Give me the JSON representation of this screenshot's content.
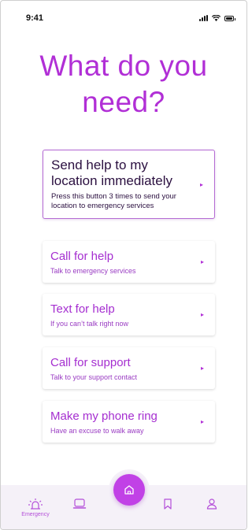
{
  "status_bar": {
    "time": "9:41",
    "signal_icon": "signal-icon",
    "wifi_icon": "wifi-icon",
    "battery_icon": "battery-icon"
  },
  "title": "What do you need?",
  "colors": {
    "accent": "#b12fd6",
    "fab": "#c141e6",
    "nav_bg": "#f5f1f8"
  },
  "actions": [
    {
      "title": "Send help to my location immediately",
      "subtitle": "Press this button 3 times to send your location to emergency services",
      "icon": "chevron-right-icon"
    },
    {
      "title": "Call for help",
      "subtitle": "Talk to emergency services",
      "icon": "chevron-right-icon"
    },
    {
      "title": "Text for help",
      "subtitle": "If you can’t talk right now",
      "icon": "chevron-right-icon"
    },
    {
      "title": "Call for support",
      "subtitle": "Talk to your support contact",
      "icon": "chevron-right-icon"
    },
    {
      "title": "Make my phone ring",
      "subtitle": "Have an excuse to walk away",
      "icon": "chevron-right-icon"
    }
  ],
  "bottom_nav": {
    "items": [
      {
        "label": "Emergency",
        "icon": "siren-icon",
        "active": true
      },
      {
        "label": "",
        "icon": "laptop-icon",
        "active": false
      },
      {
        "label": "",
        "icon": "home-icon",
        "active": false
      },
      {
        "label": "",
        "icon": "bookmark-icon",
        "active": false
      },
      {
        "label": "",
        "icon": "user-icon",
        "active": false
      }
    ]
  }
}
